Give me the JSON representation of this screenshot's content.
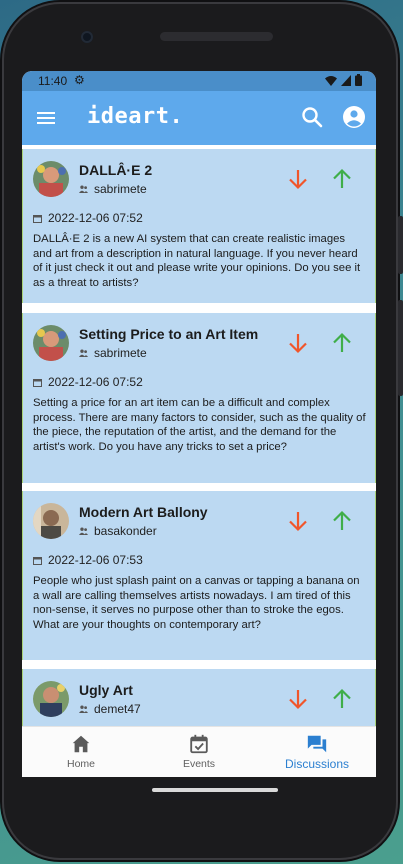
{
  "status_bar": {
    "time": "11:40"
  },
  "app_bar": {
    "title": "ideart."
  },
  "discussions": [
    {
      "title": "DALLÂ·E 2",
      "username": "sabrimete",
      "date": "2022-12-06 07:52",
      "body": "DALLÂ·E 2 is a new AI system that can create realistic images and art from a description in natural language. If you never heard of it just check it out and please write your opinions. Do you see it as a threat to artists?"
    },
    {
      "title": "Setting Price to an Art Item",
      "username": "sabrimete",
      "date": "2022-12-06 07:52",
      "body": "Setting a price for an art item can be a difficult and complex process. There are many factors to consider, such as the quality of the piece, the reputation of the artist, and the demand for the artist's work. Do you have any tricks to set a price?"
    },
    {
      "title": "Modern Art Ballony",
      "username": "basakonder",
      "date": "2022-12-06 07:53",
      "body": "People who just splash paint on a canvas or tapping a banana on a wall are calling themselves artists nowadays. I am tired of this non-sense, it serves no purpose other than to stroke the egos. What are your thoughts on contemporary art?"
    },
    {
      "title": "Ugly Art",
      "username": "demet47",
      "date": "",
      "body": ""
    }
  ],
  "bottom_nav": {
    "home": "Home",
    "events": "Events",
    "discussions": "Discussions",
    "active": "discussions"
  },
  "colors": {
    "app_bar": "#5ea9ec",
    "card_bg": "#bcd9f2",
    "downvote": "#f0562b",
    "upvote": "#3fae49",
    "active_nav": "#2b7fd0"
  }
}
